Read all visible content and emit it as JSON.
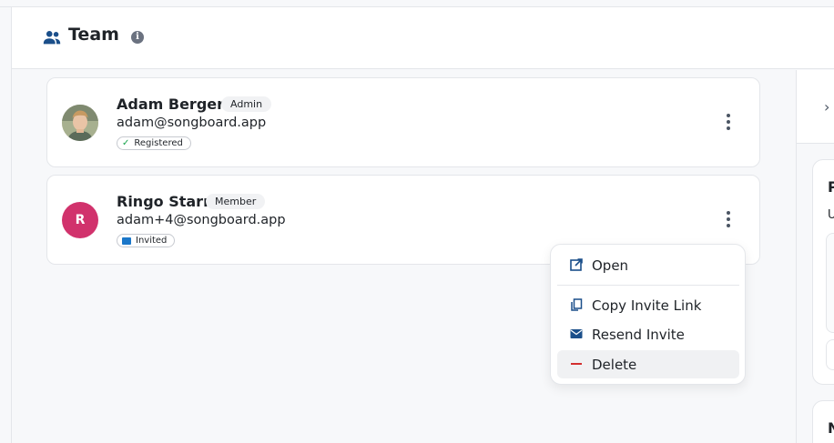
{
  "header": {
    "title": "Team",
    "team_icon": "people-group-icon",
    "info_icon_glyph": "i"
  },
  "members": [
    {
      "name": "Adam Berger",
      "role": "Admin",
      "email": "adam@songboard.app",
      "status": "Registered",
      "status_icon": "check-icon",
      "avatar_type": "photo"
    },
    {
      "name": "Ringo Starr",
      "role": "Member",
      "email": "adam+4@songboard.app",
      "status": "Invited",
      "status_icon": "mail-icon",
      "avatar_initial": "R",
      "avatar_color": "#d1326c"
    }
  ],
  "menu": {
    "items": [
      {
        "label": "Open",
        "icon": "open-external-icon"
      },
      {
        "label": "Copy Invite Link",
        "icon": "copy-icon"
      },
      {
        "label": "Resend Invite",
        "icon": "mail-icon"
      },
      {
        "label": "Delete",
        "icon": "minus-icon",
        "hovered": true
      }
    ]
  },
  "right_panel": {
    "chevron": "›",
    "card_a_title": "P",
    "card_a_sub": "U",
    "card_b_title": "N"
  },
  "colors": {
    "accent": "#1b4f8a",
    "mail_blue": "#1b77c9",
    "danger": "#d32f2f",
    "avatar_pink": "#d1326c"
  }
}
